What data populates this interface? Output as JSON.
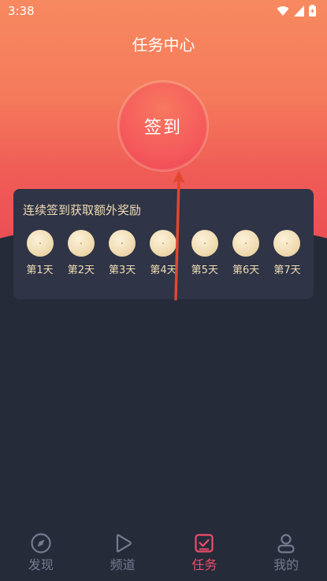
{
  "status_bar": {
    "time": "3:38"
  },
  "header": {
    "title": "任务中心"
  },
  "signin": {
    "button_label": "签到"
  },
  "bonus_card": {
    "title": "连续签到获取额外奖励",
    "days": [
      {
        "label": "第1天"
      },
      {
        "label": "第2天"
      },
      {
        "label": "第3天"
      },
      {
        "label": "第4天"
      },
      {
        "label": "第5天"
      },
      {
        "label": "第6天"
      },
      {
        "label": "第7天"
      }
    ]
  },
  "tabbar": {
    "items": [
      {
        "label": "发现",
        "icon": "compass-icon",
        "active": false
      },
      {
        "label": "频道",
        "icon": "play-icon",
        "active": false
      },
      {
        "label": "任务",
        "icon": "task-check-icon",
        "active": true
      },
      {
        "label": "我的",
        "icon": "user-icon",
        "active": false
      }
    ]
  },
  "colors": {
    "accent": "#ee4c6b",
    "card_text": "#f0dcb6",
    "background": "#262b3a",
    "annotation_arrow": "#e2462f"
  }
}
